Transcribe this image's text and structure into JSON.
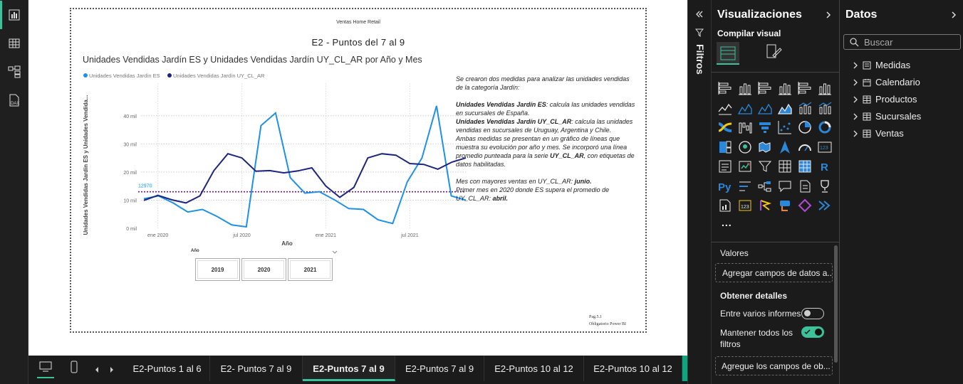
{
  "report": {
    "header_small": "Ventas Home Retail",
    "page_title": "E2 - Puntos del 7 al 9",
    "footer_line1": "Pag.5.1",
    "footer_line2": "Obligatorio Power BI"
  },
  "chart_data": {
    "type": "line",
    "title": "Unidades Vendidas Jardín ES y Unidades Vendidas Jardín UY_CL_AR por Año y Mes",
    "xlabel": "Año",
    "ylabel": "Unidades Vendidas Jardín ES y Unidades Vendida...",
    "x": [
      "2019-12",
      "2020-01",
      "2020-02",
      "2020-03",
      "2020-04",
      "2020-05",
      "2020-06",
      "2020-07",
      "2020-08",
      "2020-09",
      "2020-10",
      "2020-11",
      "2020-12",
      "2021-01",
      "2021-02",
      "2021-03",
      "2021-04",
      "2021-05",
      "2021-06",
      "2021-07",
      "2021-08"
    ],
    "x_tick_labels": [
      "ene 2020",
      "jul 2020",
      "ene 2021",
      "jul 2021"
    ],
    "y_tick_labels": [
      "0 mil",
      "10 mil",
      "20 mil",
      "30 mil",
      "40 mil"
    ],
    "ylim": [
      0,
      45000
    ],
    "series": [
      {
        "name": "Unidades Vendidas Jardín ES",
        "color": "#1e90e8",
        "values": [
          10500,
          11500,
          9000,
          5800,
          6700,
          4200,
          1200,
          500,
          36500,
          41000,
          18000,
          12500,
          13000,
          10200,
          7000,
          6700,
          3000,
          1700,
          16500,
          25000,
          43500,
          11500,
          10000
        ]
      },
      {
        "name": "Unidades Vendidas Jardín UY_CL_AR",
        "color": "#1c2580",
        "values": [
          9900,
          11700,
          10100,
          9000,
          11500,
          20500,
          26500,
          25000,
          20300,
          20500,
          19700,
          20400,
          21500,
          15000,
          11000,
          14500,
          25000,
          26500,
          26000,
          23000,
          22700,
          21000,
          23500,
          25000
        ]
      }
    ],
    "average_line": {
      "series": "Unidades Vendidas Jardín UY_CL_AR",
      "value": 12970,
      "label": "12970",
      "color": "#6e1f7e"
    }
  },
  "description": {
    "intro": "Se crearon dos medidas para analizar las unidades vendidas de la categoría Jardín:",
    "m1_name": "Unidades Vendidas Jardín ES",
    "m1_text": ": calcula las unidades vendidas en sucursales de España.",
    "m2_name": "Unidades Vendidas Jardín UY_CL_AR",
    "m2_text": ": calcula las unidades vendidas en sucursales de Uruguay, Argentina y Chile.",
    "para2_a": "Ambas medidas se presentan en un gráfico de líneas que muestra su evolución por año y mes. Se incorporó una línea promedio punteada para la serie ",
    "para2_b": "UY_CL_AR",
    "para2_c": ", con etiquetas de datos habilitadas.",
    "q1_a": "Mes con mayores ventas en UY_CL_AR: ",
    "q1_b": "junio.",
    "q2_a": "Primer mes en 2020 donde ES supera el promedio de UY_CL_AR: ",
    "q2_b": "abril."
  },
  "slicer": {
    "title": "Año",
    "options": [
      "2019",
      "2020",
      "2021"
    ]
  },
  "tabs": [
    "E2-Puntos 1 al 6",
    "E2- Puntos 7 al 9",
    "E2-Puntos 7 al 9",
    "E2-Puntos 7 al 9",
    "E2-Puntos 10 al 12",
    "E2-Puntos 10 al 12"
  ],
  "active_tab_index": 2,
  "add_tab_label": "+",
  "filters_label": "Filtros",
  "viz_panel": {
    "title": "Visualizaciones",
    "build_label": "Compilar visual",
    "more_label": "...",
    "values_label": "Valores",
    "values_placeholder": "Agregar campos de datos a...",
    "details_title": "Obtener detalles",
    "cross_report_label": "Entre varios informes",
    "keep_filters_label_1": "Mantener todos los",
    "keep_filters_label_2": "filtros",
    "drill_placeholder": "Agregue los campos de ob..."
  },
  "data_panel": {
    "title": "Datos",
    "search_placeholder": "Buscar",
    "tables": [
      "Medidas",
      "Calendario",
      "Productos",
      "Sucursales",
      "Ventas"
    ]
  }
}
